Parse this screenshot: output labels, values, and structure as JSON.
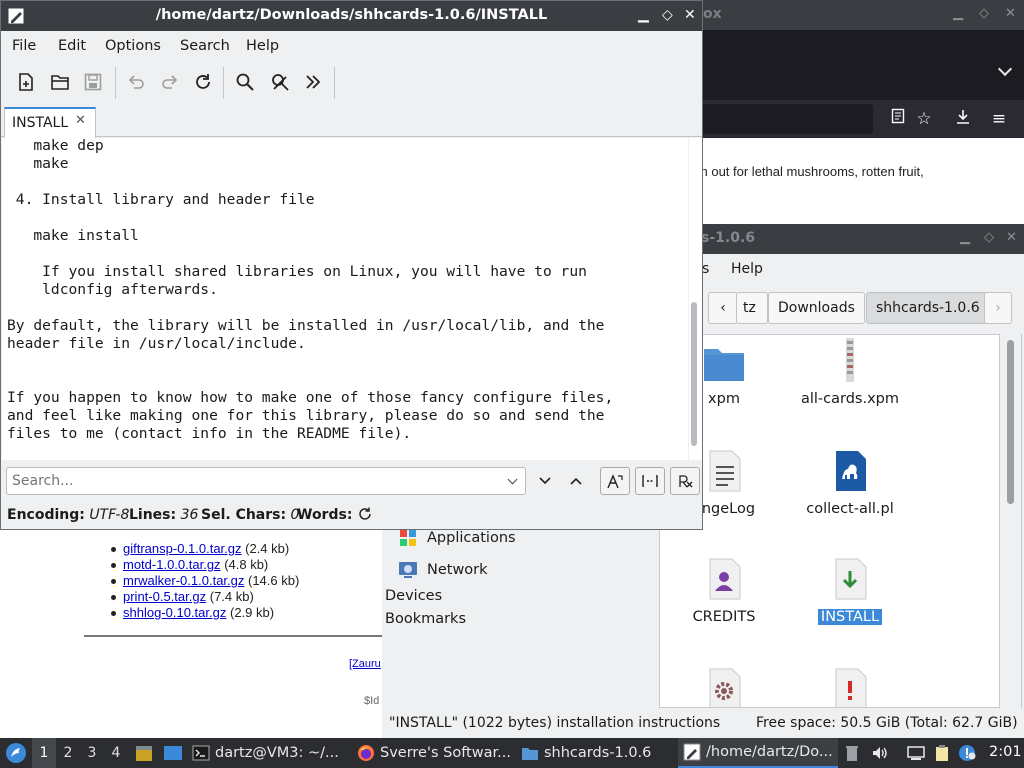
{
  "browser": {
    "title_fragment": "ox",
    "content_text": "ch out for lethal mushrooms, rotten fruit,",
    "page_files": [
      {
        "name": "giftransp-0.1.0.tar.gz",
        "size": "(2.4 kb)"
      },
      {
        "name": "motd-1.0.0.tar.gz",
        "size": "(4.8 kb)"
      },
      {
        "name": "mrwalker-0.1.0.tar.gz",
        "size": "(14.6 kb)"
      },
      {
        "name": "print-0.5.tar.gz",
        "size": "(7.4 kb)"
      },
      {
        "name": "shhlog-0.10.tar.gz",
        "size": "(2.9 kb)"
      }
    ],
    "link_fragment": "[Zauru",
    "id_fragment": "$Id"
  },
  "file_manager": {
    "title_fragment": "s-1.0.6",
    "menu": {
      "fragment": "s",
      "help": "Help"
    },
    "path": {
      "partial": "tz",
      "downloads": "Downloads",
      "current": "shhcards-1.0.6"
    },
    "sidebar": {
      "applications": "Applications",
      "network": "Network",
      "devices": "Devices",
      "bookmarks": "Bookmarks"
    },
    "files": [
      {
        "label": "xpm",
        "icon": "folder-icon"
      },
      {
        "label": "all-cards.xpm",
        "icon": "image-icon"
      },
      {
        "label": "angeLog",
        "icon": "text-file-icon"
      },
      {
        "label": "collect-all.pl",
        "icon": "perl-script-icon"
      },
      {
        "label": "CREDITS",
        "icon": "contact-file-icon"
      },
      {
        "label": "INSTALL",
        "icon": "install-file-icon",
        "selected": true
      },
      {
        "label": "",
        "icon": "settings-file-icon"
      },
      {
        "label": "",
        "icon": "readme-file-icon"
      }
    ],
    "status_left": "\"INSTALL\" (1022 bytes) installation instructions",
    "status_right": "Free space: 50.5 GiB (Total: 62.7 GiB)"
  },
  "editor": {
    "title": "/home/dartz/Downloads/shhcards-1.0.6/INSTALL",
    "menu": {
      "file": "File",
      "edit": "Edit",
      "options": "Options",
      "search": "Search",
      "help": "Help"
    },
    "tab_label": "INSTALL",
    "text": "   make dep\n   make\n\n 4. Install library and header file\n\n   make install\n\n    If you install shared libraries on Linux, you will have to run\n    ldconfig afterwards.\n\nBy default, the library will be installed in /usr/local/lib, and the\nheader file in /usr/local/include.\n\n\nIf you happen to know how to make one of those fancy configure files,\nand feel like making one for this library, please do so and send the\nfiles to me (contact info in the README file).",
    "search_placeholder": "Search...",
    "status": {
      "encoding_label": "Encoding:",
      "encoding_value": "UTF-8",
      "lines_label": "Lines:",
      "lines_value": "36",
      "sel_label": "Sel. Chars:",
      "sel_value": "0",
      "words_label": "Words:"
    }
  },
  "taskbar": {
    "workspaces": [
      "1",
      "2",
      "3",
      "4"
    ],
    "active_workspace": "1",
    "tasks": [
      {
        "label": "dartz@VM3: ~/...",
        "icon": "terminal-icon"
      },
      {
        "label": "Sverre's Softwar...",
        "icon": "firefox-icon"
      },
      {
        "label": "shhcards-1.0.6",
        "icon": "folder-icon"
      },
      {
        "label": "/home/dartz/Do...",
        "icon": "text-editor-icon",
        "active": true
      }
    ],
    "clock": "2:01"
  },
  "colors": {
    "accent": "#3c89d9",
    "titlebar": "#3a3d41",
    "taskbar": "#2b2d31"
  }
}
